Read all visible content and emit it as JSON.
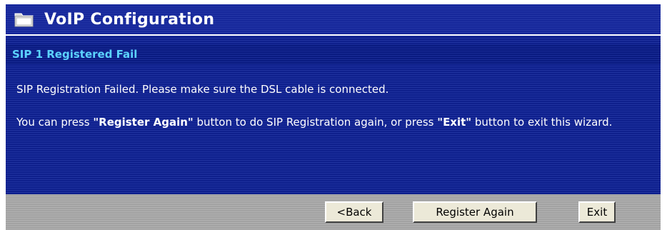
{
  "window": {
    "title": "VoIP Configuration",
    "title_icon": "folder-icon"
  },
  "section": {
    "title": "SIP 1 Registered Fail"
  },
  "messages": {
    "line1": "SIP Registration Failed. Please make sure the DSL cable is connected.",
    "line2_part1": "You can press ",
    "line2_bold1": "\"Register Again\"",
    "line2_part2": " button to do SIP Registration again, or press ",
    "line2_bold2": "\"Exit\"",
    "line2_part3": " button to exit this wizard."
  },
  "buttons": {
    "back_label": "<Back",
    "register_label": "Register Again",
    "exit_label": "Exit"
  },
  "colors": {
    "panel_blue": "#10218e",
    "section_title": "#5cd3ff",
    "bottom_gray": "#a8a8a8"
  }
}
